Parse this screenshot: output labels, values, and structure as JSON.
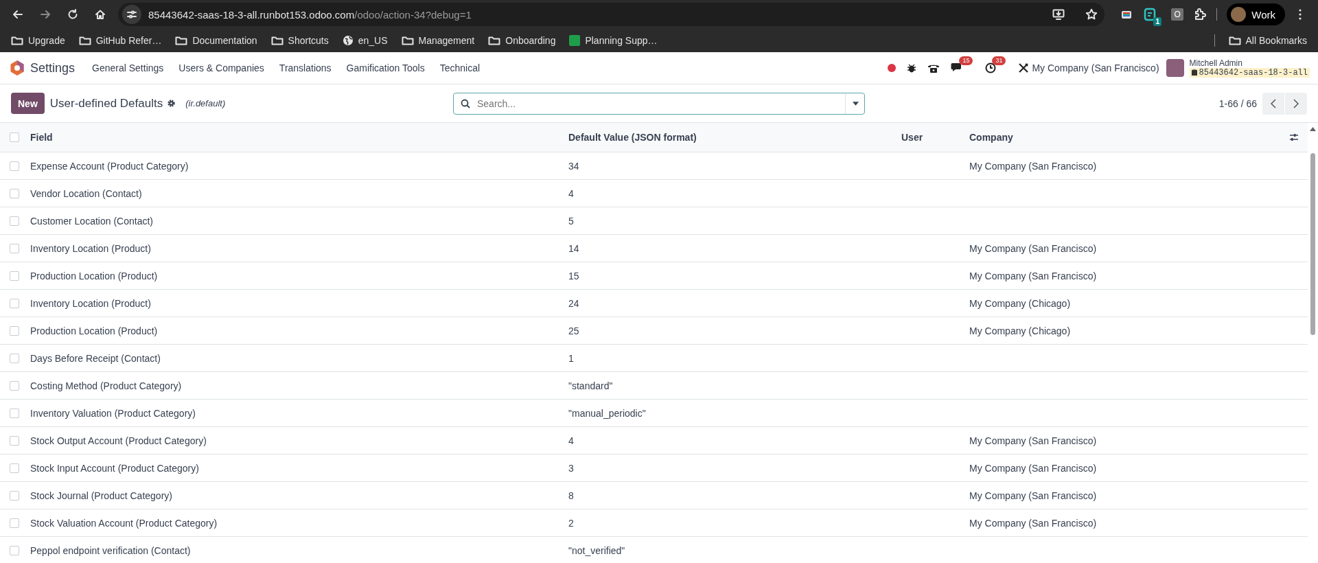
{
  "browser": {
    "url_host": "85443642-saas-18-3-all.runbot153.odoo.com",
    "url_path": "/odoo/action-34?debug=1",
    "extension_badge": "1",
    "extension_letter": "O",
    "profile": "Work",
    "bookmarks": [
      {
        "kind": "folder",
        "label": "Upgrade"
      },
      {
        "kind": "folder",
        "label": "GitHub Refer…"
      },
      {
        "kind": "folder",
        "label": "Documentation"
      },
      {
        "kind": "folder",
        "label": "Shortcuts"
      },
      {
        "kind": "globe",
        "label": "en_US"
      },
      {
        "kind": "folder",
        "label": "Management"
      },
      {
        "kind": "folder",
        "label": "Onboarding"
      },
      {
        "kind": "app",
        "label": "Planning Supp…"
      }
    ],
    "all_bookmarks": "All Bookmarks"
  },
  "navbar": {
    "app": "Settings",
    "menus": [
      "General Settings",
      "Users & Companies",
      "Translations",
      "Gamification Tools",
      "Technical"
    ],
    "messages_count": "15",
    "activities_count": "31",
    "company": "My Company (San Francisco)",
    "user": "Mitchell Admin",
    "database": "85443642-saas-18-3-all"
  },
  "control_panel": {
    "new_button": "New",
    "title": "User-defined Defaults",
    "model": "(ir.default)",
    "search": {
      "placeholder": "Search..."
    },
    "pager": "1-66 / 66"
  },
  "table": {
    "all_selected": false,
    "columns": [
      "Field",
      "Default Value (JSON format)",
      "User",
      "Company"
    ],
    "rows": [
      {
        "selected": false,
        "field": "Expense Account (Product Category)",
        "value": "34",
        "user": "",
        "company": "My Company (San Francisco)"
      },
      {
        "selected": false,
        "field": "Vendor Location (Contact)",
        "value": "4",
        "user": "",
        "company": ""
      },
      {
        "selected": false,
        "field": "Customer Location (Contact)",
        "value": "5",
        "user": "",
        "company": ""
      },
      {
        "selected": false,
        "field": "Inventory Location (Product)",
        "value": "14",
        "user": "",
        "company": "My Company (San Francisco)"
      },
      {
        "selected": false,
        "field": "Production Location (Product)",
        "value": "15",
        "user": "",
        "company": "My Company (San Francisco)"
      },
      {
        "selected": false,
        "field": "Inventory Location (Product)",
        "value": "24",
        "user": "",
        "company": "My Company (Chicago)"
      },
      {
        "selected": false,
        "field": "Production Location (Product)",
        "value": "25",
        "user": "",
        "company": "My Company (Chicago)"
      },
      {
        "selected": false,
        "field": "Days Before Receipt (Contact)",
        "value": "1",
        "user": "",
        "company": ""
      },
      {
        "selected": false,
        "field": "Costing Method (Product Category)",
        "value": "\"standard\"",
        "user": "",
        "company": ""
      },
      {
        "selected": false,
        "field": "Inventory Valuation (Product Category)",
        "value": "\"manual_periodic\"",
        "user": "",
        "company": ""
      },
      {
        "selected": false,
        "field": "Stock Output Account (Product Category)",
        "value": "4",
        "user": "",
        "company": "My Company (San Francisco)"
      },
      {
        "selected": false,
        "field": "Stock Input Account (Product Category)",
        "value": "3",
        "user": "",
        "company": "My Company (San Francisco)"
      },
      {
        "selected": false,
        "field": "Stock Journal (Product Category)",
        "value": "8",
        "user": "",
        "company": "My Company (San Francisco)"
      },
      {
        "selected": false,
        "field": "Stock Valuation Account (Product Category)",
        "value": "2",
        "user": "",
        "company": "My Company (San Francisco)"
      },
      {
        "selected": false,
        "field": "Peppol endpoint verification (Contact)",
        "value": "\"not_verified\"",
        "user": "",
        "company": ""
      }
    ]
  }
}
